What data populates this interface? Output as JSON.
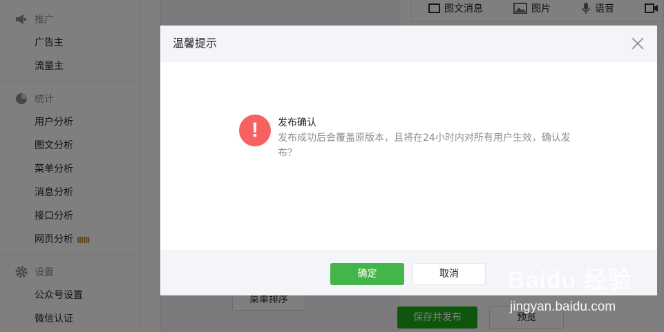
{
  "sidebar": {
    "groups": [
      {
        "title": "推广",
        "icon": "megaphone-icon",
        "items": [
          "广告主",
          "流量主"
        ]
      },
      {
        "title": "统计",
        "icon": "pie-chart-icon",
        "items": [
          "用户分析",
          "图文分析",
          "菜单分析",
          "消息分析",
          "接口分析",
          "网页分析"
        ]
      },
      {
        "title": "设置",
        "icon": "gear-icon",
        "items": [
          "公众号设置",
          "微信认证"
        ]
      }
    ]
  },
  "media_tabs": [
    {
      "label": "图文消息",
      "icon": "article-icon"
    },
    {
      "label": "图片",
      "icon": "image-icon"
    },
    {
      "label": "语音",
      "icon": "microphone-icon"
    }
  ],
  "background_buttons": {
    "sort": "菜单排序",
    "save_publish": "保存并发布",
    "preview": "预览"
  },
  "dialog": {
    "title": "温馨提示",
    "message_title": "发布确认",
    "message_body": "发布成功后会覆盖原版本，且将在24小时内对所有用户生效，确认发布？",
    "confirm": "确定",
    "cancel": "取消"
  },
  "watermark": {
    "brand": "Baidu 经验",
    "url": "jingyan.baidu.com"
  },
  "colors": {
    "primary_green": "#44b549",
    "warn_red": "#f76260",
    "overlay": "rgba(0,0,0,0.5)"
  }
}
